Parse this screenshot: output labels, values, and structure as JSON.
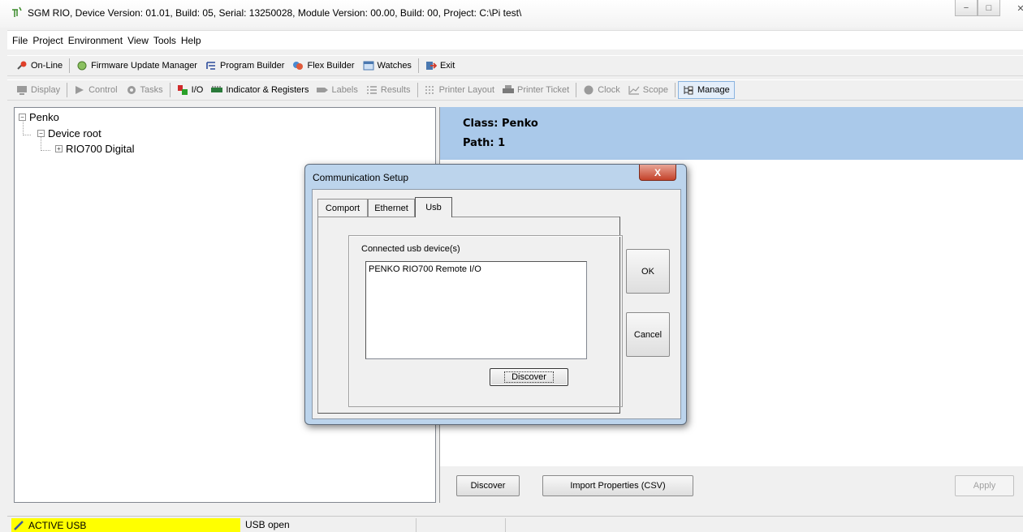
{
  "window": {
    "title": "SGM RIO, Device Version: 01.01, Build: 05, Serial: 13250028, Module Version: 00.00, Build: 00, Project: C:\\Pi test\\",
    "minimize_icon": "minimize-icon",
    "maximize_icon": "maximize-icon",
    "close_icon": "close-icon"
  },
  "menu": [
    "File",
    "Project",
    "Environment",
    "View",
    "Tools",
    "Help"
  ],
  "toolbar_main": {
    "online": "On-Line",
    "firmware": "Firmware Update Manager",
    "program_builder": "Program Builder",
    "flex_builder": "Flex Builder",
    "watches": "Watches",
    "exit": "Exit"
  },
  "toolbar_view": {
    "display": "Display",
    "control": "Control",
    "tasks": "Tasks",
    "io": "I/O",
    "indicator": "Indicator & Registers",
    "labels": "Labels",
    "results": "Results",
    "printer_layout": "Printer Layout",
    "printer_ticket": "Printer Ticket",
    "clock": "Clock",
    "scope": "Scope",
    "manage": "Manage"
  },
  "tree": {
    "root": "Penko",
    "device_root": "Device root",
    "module": "RIO700 Digital"
  },
  "properties": {
    "class": "Class: Penko",
    "path": "Path: 1"
  },
  "right_buttons": {
    "discover": "Discover",
    "import": "Import Properties (CSV)",
    "apply": "Apply"
  },
  "status": {
    "active": "ACTIVE USB",
    "state": "USB open"
  },
  "dialog": {
    "title": "Communication Setup",
    "close": "X",
    "tabs": [
      "Comport",
      "Ethernet",
      "Usb"
    ],
    "selected_tab": "Usb",
    "group_label": "Connected usb device(s)",
    "devices": [
      "PENKO RIO700 Remote I/O"
    ],
    "discover": "Discover",
    "ok": "OK",
    "cancel": "Cancel"
  },
  "colors": {
    "header_blue": "#aac9ea",
    "status_yellow": "#ffff00",
    "dialog_frame": "#bcd4ec"
  }
}
